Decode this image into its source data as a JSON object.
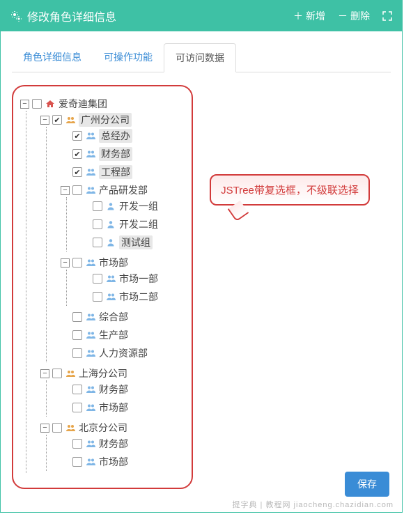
{
  "header": {
    "title": "修改角色详细信息",
    "add_label": "新增",
    "delete_label": "删除"
  },
  "tabs": {
    "details": "角色详细信息",
    "operable": "可操作功能",
    "accessible": "可访问数据"
  },
  "callout": "JSTree带复选框，不级联选择",
  "save_label": "保存",
  "watermark": "提字典 | 教程网  jiaocheng.chazidian.com",
  "tree": {
    "root": {
      "label": "爱奇迪集团",
      "checked": false,
      "expanded": true
    },
    "gz": {
      "label": "广州分公司",
      "checked": true,
      "hl": true,
      "expanded": true,
      "children": [
        {
          "key": "zjb",
          "label": "总经办",
          "checked": true,
          "hl": true,
          "icon": "group"
        },
        {
          "key": "cwb",
          "label": "财务部",
          "checked": true,
          "hl": true,
          "icon": "group"
        },
        {
          "key": "gcb",
          "label": "工程部",
          "checked": true,
          "hl": true,
          "icon": "group"
        }
      ],
      "rd": {
        "label": "产品研发部",
        "checked": false,
        "expanded": true,
        "icon": "group",
        "children": [
          {
            "key": "kf1",
            "label": "开发一组",
            "checked": false,
            "icon": "person"
          },
          {
            "key": "kf2",
            "label": "开发二组",
            "checked": false,
            "icon": "person"
          },
          {
            "key": "csz",
            "label": "测试组",
            "checked": false,
            "hl": true,
            "icon": "person"
          }
        ]
      },
      "market": {
        "label": "市场部",
        "checked": false,
        "expanded": true,
        "icon": "group",
        "children": [
          {
            "key": "sc1",
            "label": "市场一部",
            "checked": false,
            "icon": "group"
          },
          {
            "key": "sc2",
            "label": "市场二部",
            "checked": false,
            "icon": "group"
          }
        ]
      },
      "others": [
        {
          "key": "zhb",
          "label": "综合部",
          "checked": false,
          "icon": "group"
        },
        {
          "key": "scb",
          "label": "生产部",
          "checked": false,
          "icon": "group"
        },
        {
          "key": "rlb",
          "label": "人力资源部",
          "checked": false,
          "icon": "group"
        }
      ]
    },
    "sh": {
      "label": "上海分公司",
      "checked": false,
      "expanded": true,
      "children": [
        {
          "key": "shcw",
          "label": "财务部",
          "checked": false,
          "icon": "group"
        },
        {
          "key": "shsc",
          "label": "市场部",
          "checked": false,
          "icon": "group"
        }
      ]
    },
    "bj": {
      "label": "北京分公司",
      "checked": false,
      "expanded": true,
      "children": [
        {
          "key": "bjcw",
          "label": "财务部",
          "checked": false,
          "icon": "group"
        },
        {
          "key": "bjsc",
          "label": "市场部",
          "checked": false,
          "icon": "group"
        }
      ]
    }
  }
}
